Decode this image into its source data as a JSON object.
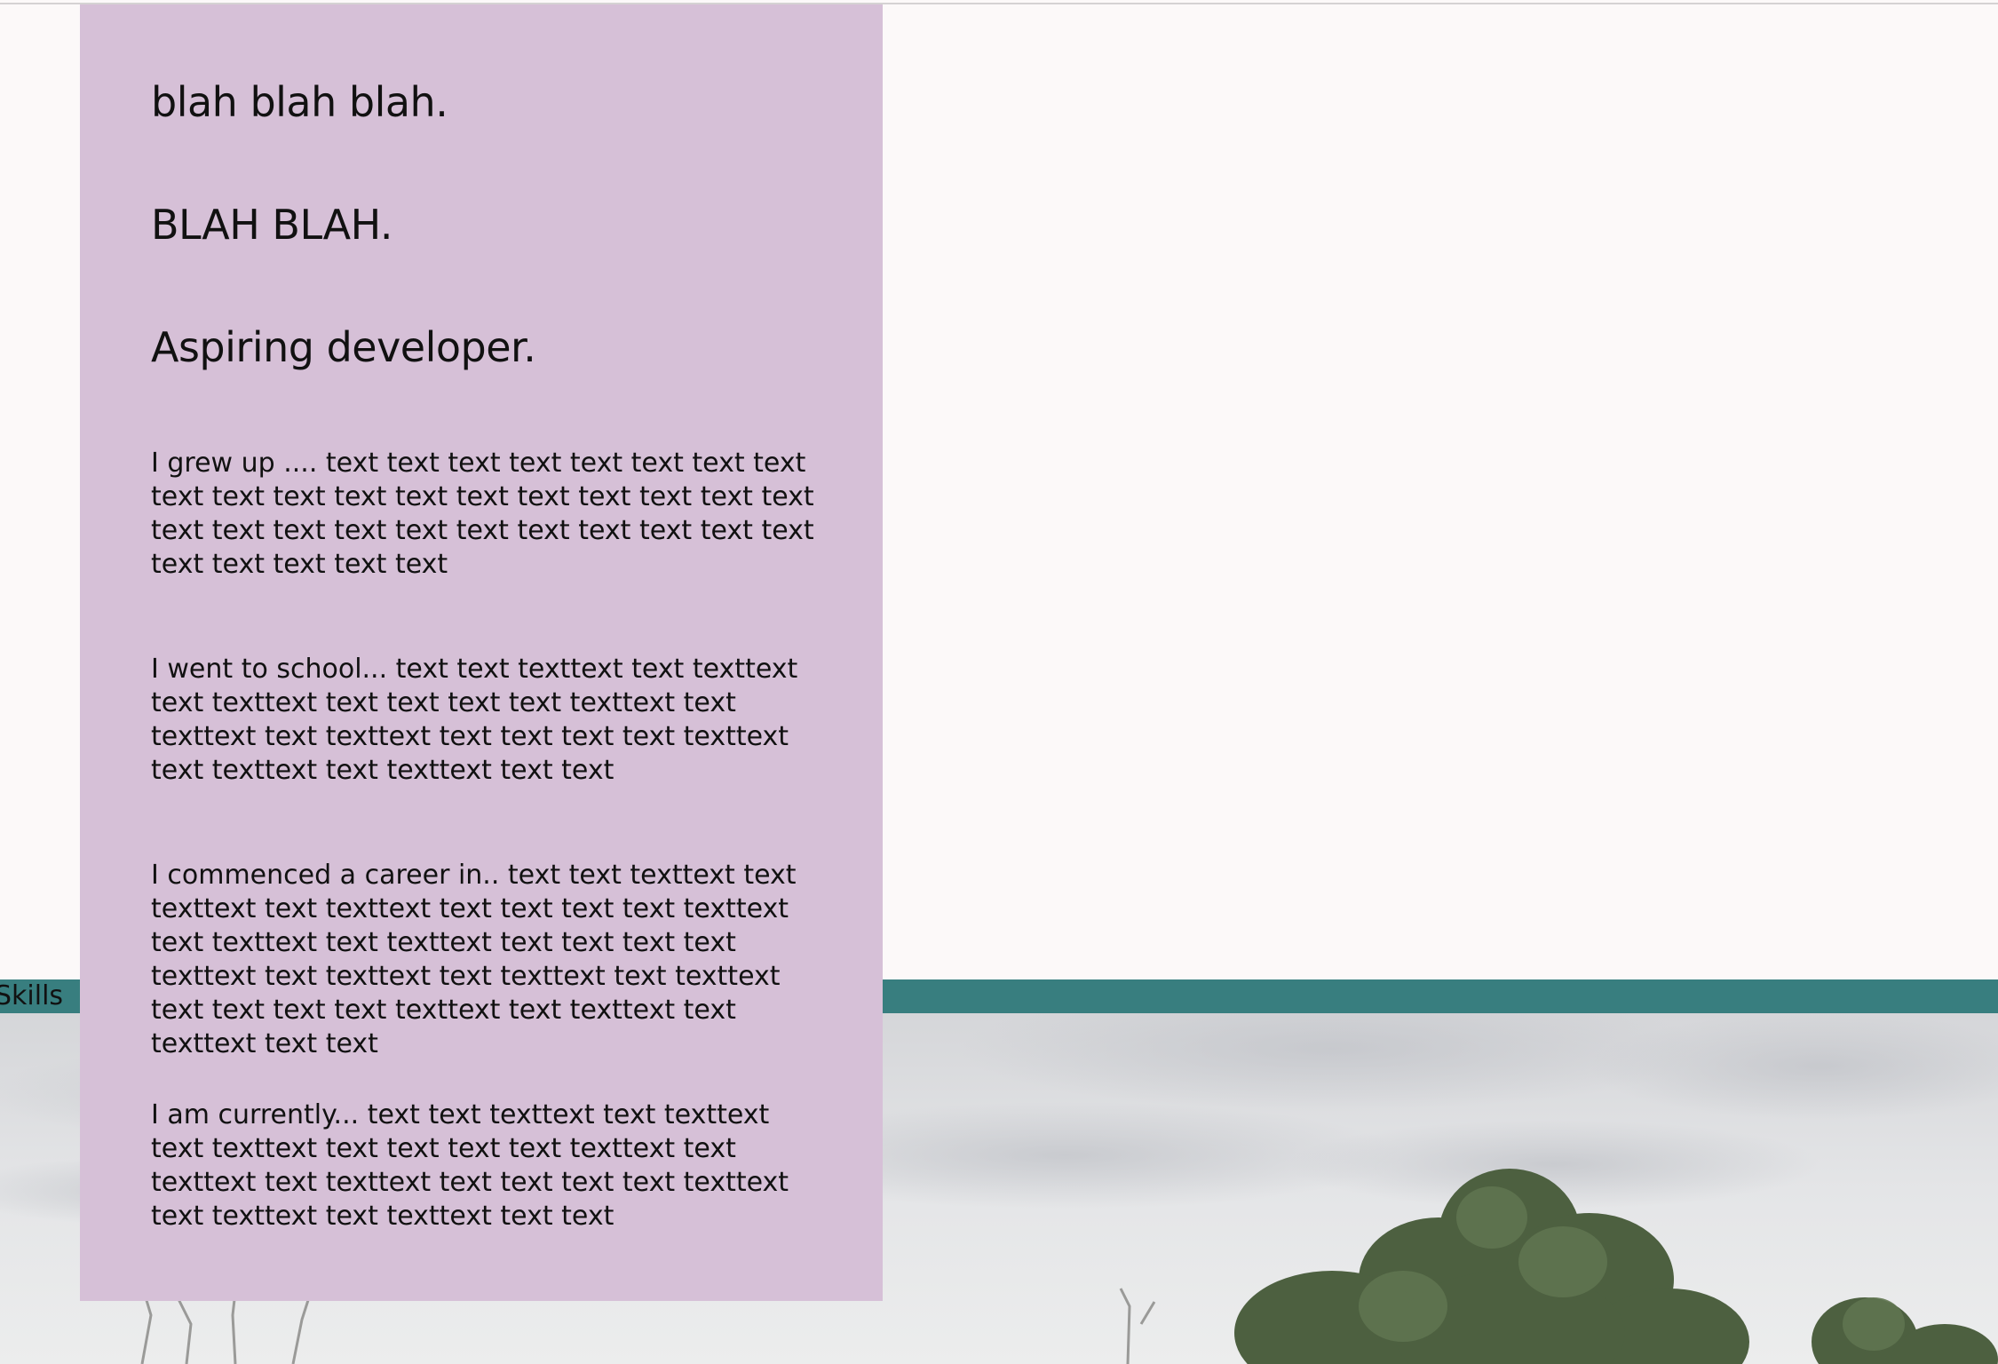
{
  "about": {
    "heading_1": "blah blah blah.",
    "heading_2": "BLAH BLAH.",
    "heading_3": "Aspiring developer.",
    "paragraph_1": "I grew up .... text text text text text text text text text text text text text text text text text text text text text text text text text text text text text text text text text text text",
    "paragraph_2": "I went to school... text text texttext text texttext text texttext text text text text texttext text texttext text texttext text text text text texttext text texttext text texttext text text",
    "paragraph_3": "I commenced a career in.. text text texttext text texttext text texttext text text text text texttext text texttext text texttext text text text text texttext text texttext text texttext text texttext text text text text texttext text texttext text texttext text text",
    "paragraph_4": "I am currently... text text texttext text texttext text texttext text text text text texttext text texttext text texttext text text text text texttext text texttext text texttext text text"
  },
  "nav": {
    "skills_label": "Skills"
  },
  "colors": {
    "page_background": "#fcf9f9",
    "card_background": "#d6c0d7",
    "teal_bar": "#387e7f"
  }
}
